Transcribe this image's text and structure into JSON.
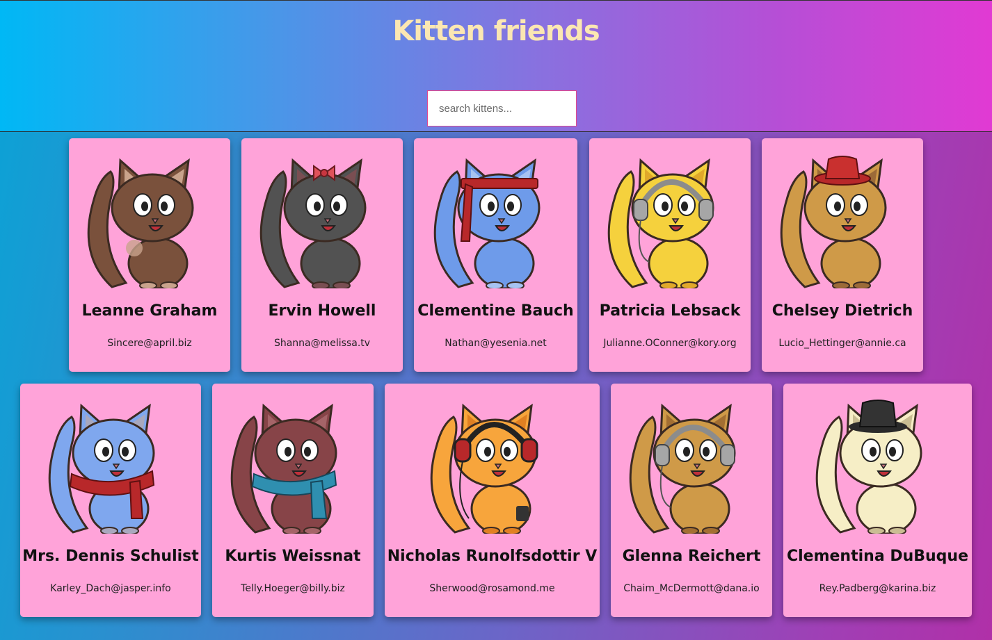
{
  "app": {
    "title": "Kitten friends"
  },
  "search": {
    "placeholder": "search kittens...",
    "value": ""
  },
  "colors": {
    "card_background": "#ffa3d9",
    "title_color": "#fbe7b2"
  },
  "kittens": [
    {
      "name": "Leanne Graham",
      "email": "Sincere@april.biz",
      "icon": "brown-patched-cat",
      "body": "#7a513c",
      "accent": "#c9a38c",
      "accessory": "none"
    },
    {
      "name": "Ervin Howell",
      "email": "Shanna@melissa.tv",
      "icon": "gray-cat-with-bow",
      "body": "#525252",
      "accent": "#7a4e52",
      "accessory": "bow"
    },
    {
      "name": "Clementine Bauch",
      "email": "Nathan@yesenia.net",
      "icon": "blue-cat-with-headband",
      "body": "#6e9bea",
      "accent": "#a7c3f2",
      "accessory": "headband"
    },
    {
      "name": "Patricia Lebsack",
      "email": "Julianne.OConner@kory.org",
      "icon": "yellow-cat-with-headphones",
      "body": "#f5d13d",
      "accent": "#e0a82a",
      "accessory": "headphones"
    },
    {
      "name": "Chelsey Dietrich",
      "email": "Lucio_Hettinger@annie.ca",
      "icon": "tan-cat-with-hat",
      "body": "#cf9a48",
      "accent": "#9b6a38",
      "accessory": "red-hat"
    },
    {
      "name": "Mrs. Dennis Schulist",
      "email": "Karley_Dach@jasper.info",
      "icon": "blue-cat-with-scarf",
      "body": "#7fa7ee",
      "accent": "#a8a8be",
      "accessory": "red-scarf"
    },
    {
      "name": "Kurtis Weissnat",
      "email": "Telly.Hoeger@billy.biz",
      "icon": "maroon-cat-with-scarf",
      "body": "#874448",
      "accent": "#a56468",
      "accessory": "teal-scarf"
    },
    {
      "name": "Nicholas Runolfsdottir V",
      "email": "Sherwood@rosamond.me",
      "icon": "orange-cat-with-headphones",
      "body": "#f7a53c",
      "accent": "#e08022",
      "accessory": "red-headphones"
    },
    {
      "name": "Glenna Reichert",
      "email": "Chaim_McDermott@dana.io",
      "icon": "tan-cat-with-headphones",
      "body": "#cf9a48",
      "accent": "#a36f32",
      "accessory": "headphones"
    },
    {
      "name": "Clementina DuBuque",
      "email": "Rey.Padberg@karina.biz",
      "icon": "cream-cat-with-top-hat",
      "body": "#f6eec6",
      "accent": "#c9bd92",
      "accessory": "black-hat"
    }
  ]
}
